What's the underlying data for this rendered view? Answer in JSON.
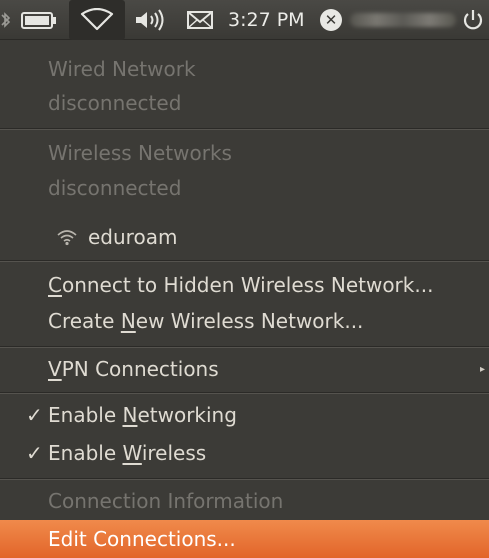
{
  "panel": {
    "clock": "3:27 PM",
    "icons": [
      "bluetooth-icon",
      "battery-icon",
      "network-wireless-icon",
      "volume-icon",
      "mail-icon",
      "user-status-icon",
      "power-icon"
    ]
  },
  "menu": {
    "wired_title": "Wired Network",
    "wired_status": "disconnected",
    "wireless_title": "Wireless Networks",
    "wireless_status": "disconnected",
    "network_eduroam": "eduroam",
    "connect_hidden": {
      "pre": "",
      "key": "C",
      "post": "onnect to Hidden Wireless Network..."
    },
    "create_new": {
      "pre": "Create ",
      "key": "N",
      "post": "ew Wireless Network..."
    },
    "vpn": {
      "pre": "",
      "key": "V",
      "post": "PN Connections"
    },
    "enable_networking": {
      "pre": "Enable ",
      "key": "N",
      "post": "etworking",
      "checked": true
    },
    "enable_wireless": {
      "pre": "Enable ",
      "key": "W",
      "post": "ireless",
      "checked": true
    },
    "connection_info": "Connection Information",
    "edit_connections": "Edit Connections..."
  },
  "colors": {
    "panel_bg": "#3c3b37",
    "menu_text": "#dfdbd2",
    "disabled_text": "#76746f",
    "highlight": "#e96d33"
  }
}
